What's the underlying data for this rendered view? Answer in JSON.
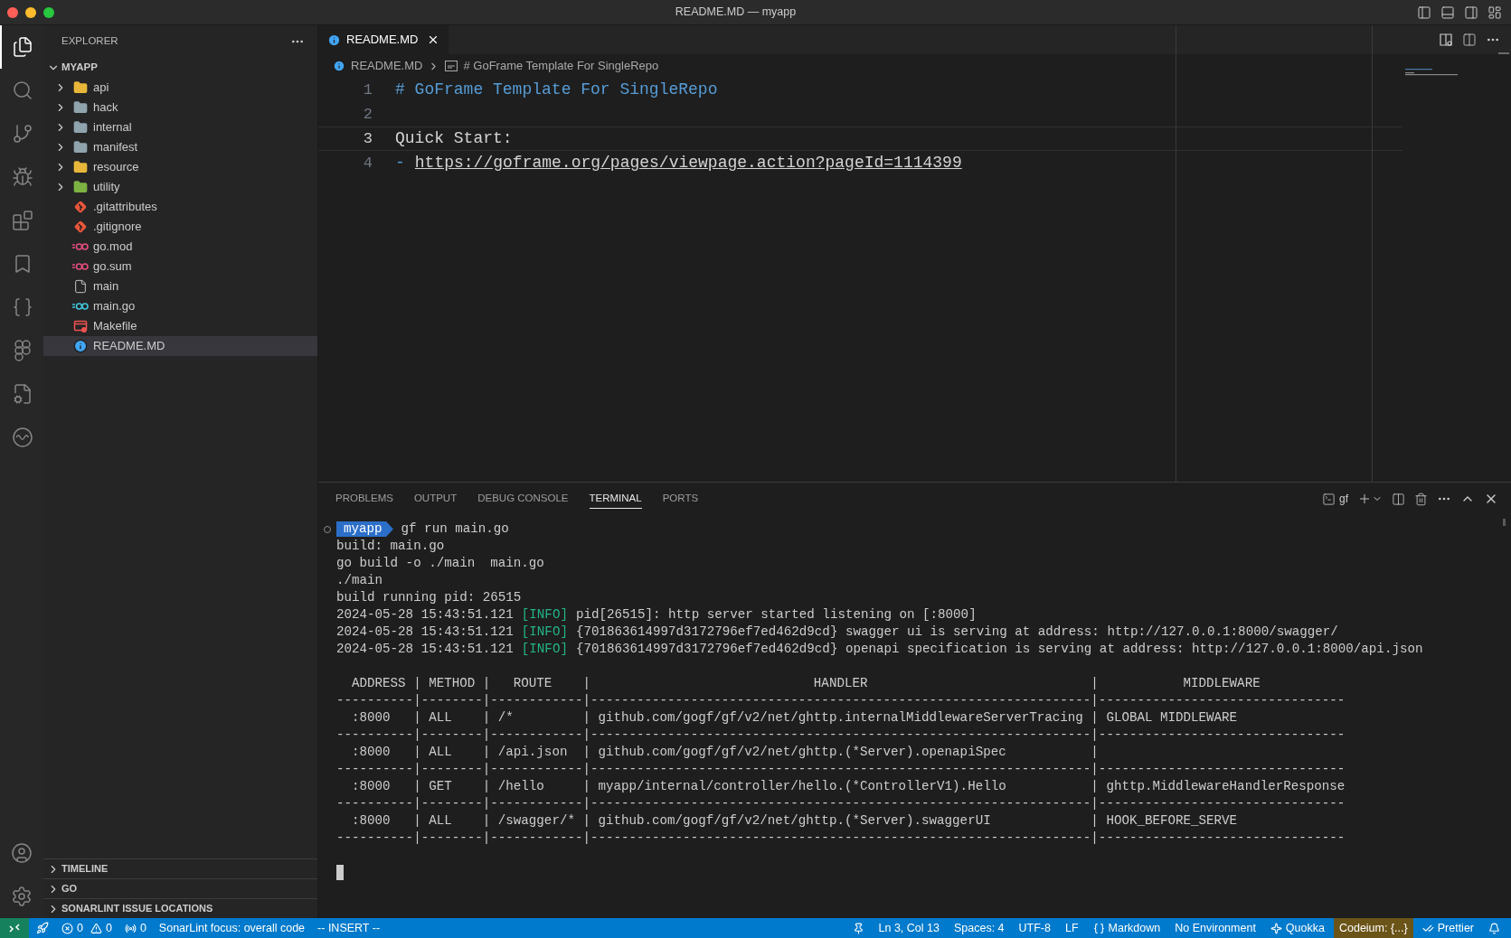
{
  "window": {
    "title": "README.MD — myapp"
  },
  "activity_bar": {
    "items": [
      {
        "kind": "explorer",
        "selected": true
      },
      {
        "kind": "search",
        "selected": false
      },
      {
        "kind": "source-control",
        "selected": false
      },
      {
        "kind": "run-debug",
        "selected": false
      },
      {
        "kind": "extensions",
        "selected": false
      },
      {
        "kind": "bookmarks",
        "selected": false
      },
      {
        "kind": "braces",
        "selected": false
      },
      {
        "kind": "circles",
        "selected": false
      },
      {
        "kind": "file-gear",
        "selected": false
      },
      {
        "kind": "wave",
        "selected": false
      }
    ],
    "bottom": [
      {
        "kind": "account"
      },
      {
        "kind": "settings"
      }
    ]
  },
  "sidebar": {
    "title": "EXPLORER",
    "folder": {
      "name": "MYAPP",
      "expanded": true
    },
    "items": [
      {
        "name": "api",
        "kind": "folder",
        "color": "#e8b73a",
        "selected": false
      },
      {
        "name": "hack",
        "kind": "folder",
        "color": "#90a4ae",
        "selected": false
      },
      {
        "name": "internal",
        "kind": "folder",
        "color": "#90a4ae",
        "selected": false
      },
      {
        "name": "manifest",
        "kind": "folder",
        "color": "#90a4ae",
        "selected": false
      },
      {
        "name": "resource",
        "kind": "folder",
        "color": "#e8b73a",
        "selected": false
      },
      {
        "name": "utility",
        "kind": "folder",
        "color": "#7cb342",
        "selected": false
      },
      {
        "name": ".gitattributes",
        "kind": "git",
        "selected": false
      },
      {
        "name": ".gitignore",
        "kind": "git",
        "selected": false
      },
      {
        "name": "go.mod",
        "kind": "go-mod",
        "selected": false
      },
      {
        "name": "go.sum",
        "kind": "go-mod",
        "selected": false
      },
      {
        "name": "main",
        "kind": "file",
        "selected": false
      },
      {
        "name": "main.go",
        "kind": "go",
        "selected": false
      },
      {
        "name": "Makefile",
        "kind": "makefile",
        "selected": false
      },
      {
        "name": "README.MD",
        "kind": "info",
        "selected": true
      }
    ],
    "sections": [
      "TIMELINE",
      "GO",
      "SONARLINT ISSUE LOCATIONS"
    ]
  },
  "editor": {
    "tab": {
      "label": "README.MD"
    },
    "breadcrumbs": [
      "README.MD",
      "# GoFrame Template For SingleRepo"
    ],
    "lines": [
      {
        "number": "1",
        "kind": "heading",
        "text": "# GoFrame Template For SingleRepo",
        "current": false
      },
      {
        "number": "2",
        "kind": "empty",
        "current": false
      },
      {
        "number": "3",
        "kind": "text",
        "text": "Quick Start:",
        "current": true
      },
      {
        "number": "4",
        "kind": "list-link",
        "bullet": "-",
        "text": "https://goframe.org/pages/viewpage.action?pageId=1114399",
        "current": false
      }
    ]
  },
  "panel": {
    "tabs": [
      {
        "label": "PROBLEMS",
        "selected": false
      },
      {
        "label": "OUTPUT",
        "selected": false
      },
      {
        "label": "DEBUG CONSOLE",
        "selected": false
      },
      {
        "label": "TERMINAL",
        "selected": true
      },
      {
        "label": "PORTS",
        "selected": false
      }
    ],
    "terminal_name": "gf",
    "lines": [
      {
        "kind": "prompt",
        "dir": "myapp",
        "text": "gf run main.go"
      },
      {
        "kind": "text",
        "text": "build: main.go"
      },
      {
        "kind": "text",
        "text": "go build -o ./main  main.go"
      },
      {
        "kind": "text",
        "text": "./main"
      },
      {
        "kind": "text",
        "text": "build running pid: 26515"
      },
      {
        "kind": "log",
        "time": "2024-05-28 15:43:51.121",
        "level": "[INFO]",
        "text": "pid[26515]: http server started listening on [:8000]"
      },
      {
        "kind": "log",
        "time": "2024-05-28 15:43:51.121",
        "level": "[INFO]",
        "text": "{701863614997d3172796ef7ed462d9cd} swagger ui is serving at address: http://127.0.0.1:8000/swagger/"
      },
      {
        "kind": "log",
        "time": "2024-05-28 15:43:51.121",
        "level": "[INFO]",
        "text": "{701863614997d3172796ef7ed462d9cd} openapi specification is serving at address: http://127.0.0.1:8000/api.json"
      },
      {
        "kind": "blank"
      },
      {
        "kind": "text",
        "text": "  ADDRESS | METHOD |   ROUTE    |                             HANDLER                             |           MIDDLEWARE"
      },
      {
        "kind": "text",
        "text": "----------|--------|------------|-----------------------------------------------------------------|--------------------------------"
      },
      {
        "kind": "text",
        "text": "  :8000   | ALL    | /*         | github.com/gogf/gf/v2/net/ghttp.internalMiddlewareServerTracing | GLOBAL MIDDLEWARE"
      },
      {
        "kind": "text",
        "text": "----------|--------|------------|-----------------------------------------------------------------|--------------------------------"
      },
      {
        "kind": "text",
        "text": "  :8000   | ALL    | /api.json  | github.com/gogf/gf/v2/net/ghttp.(*Server).openapiSpec           |"
      },
      {
        "kind": "text",
        "text": "----------|--------|------------|-----------------------------------------------------------------|--------------------------------"
      },
      {
        "kind": "text",
        "text": "  :8000   | GET    | /hello     | myapp/internal/controller/hello.(*ControllerV1).Hello           | ghttp.MiddlewareHandlerResponse"
      },
      {
        "kind": "text",
        "text": "----------|--------|------------|-----------------------------------------------------------------|--------------------------------"
      },
      {
        "kind": "text",
        "text": "  :8000   | ALL    | /swagger/* | github.com/gogf/gf/v2/net/ghttp.(*Server).swaggerUI             | HOOK_BEFORE_SERVE"
      },
      {
        "kind": "text",
        "text": "----------|--------|------------|-----------------------------------------------------------------|--------------------------------"
      },
      {
        "kind": "blank"
      },
      {
        "kind": "cursor"
      }
    ]
  },
  "status_bar": {
    "left": [
      {
        "kind": "remote"
      },
      {
        "kind": "rocket"
      },
      {
        "kind": "problems",
        "errors": "0",
        "warnings": "0"
      },
      {
        "kind": "ports",
        "text": "0"
      },
      {
        "kind": "text",
        "text": "SonarLint focus: overall code"
      },
      {
        "kind": "text",
        "text": "-- INSERT --"
      }
    ],
    "right": [
      {
        "kind": "pin"
      },
      {
        "kind": "text",
        "text": "Ln 3, Col 13"
      },
      {
        "kind": "text",
        "text": "Spaces: 4"
      },
      {
        "kind": "text",
        "text": "UTF-8"
      },
      {
        "kind": "text",
        "text": "LF"
      },
      {
        "kind": "language",
        "text": "Markdown"
      },
      {
        "kind": "text",
        "text": "No Environment"
      },
      {
        "kind": "quokka",
        "text": "Quokka"
      },
      {
        "kind": "highlight",
        "text": "Codeium: {...}"
      },
      {
        "kind": "prettier",
        "text": "Prettier"
      },
      {
        "kind": "bell"
      }
    ]
  }
}
